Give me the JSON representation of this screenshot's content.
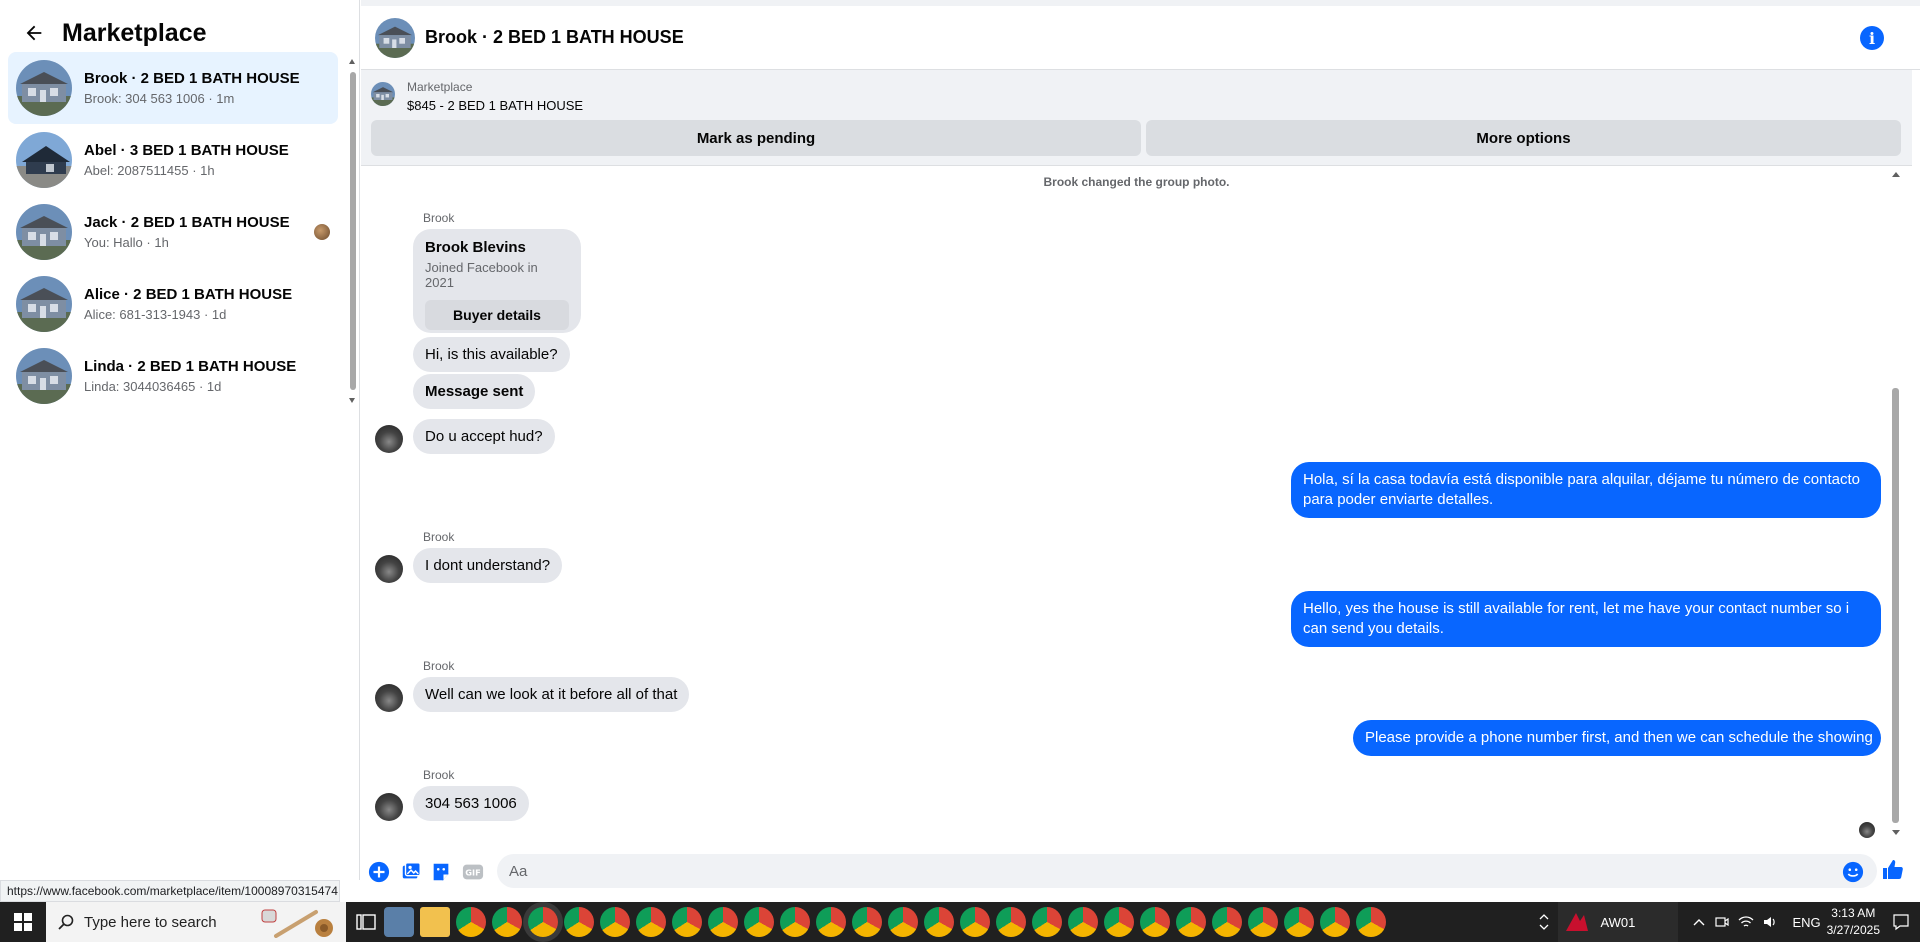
{
  "sidebar": {
    "title": "Marketplace",
    "conversations": [
      {
        "name": "Brook · 2 BED 1 BATH HOUSE",
        "preview": "Brook: 304 563 1006 · 1m"
      },
      {
        "name": "Abel · 3 BED 1 BATH HOUSE",
        "preview": "Abel: 2087511455 · 1h"
      },
      {
        "name": "Jack · 2 BED 1 BATH HOUSE",
        "preview": "You: Hallo · 1h"
      },
      {
        "name": "Alice · 2 BED 1 BATH HOUSE",
        "preview": "Alice: 681-313-1943 · 1d"
      },
      {
        "name": "Linda · 2 BED 1 BATH HOUSE",
        "preview": "Linda: 3044036465 · 1d"
      }
    ]
  },
  "status_url": "https://www.facebook.com/marketplace/item/10008970315474",
  "chat": {
    "title": "Brook · 2 BED 1 BATH HOUSE",
    "listing": {
      "source": "Marketplace",
      "price_title": "$845 - 2 BED 1 BATH HOUSE",
      "mark_pending": "Mark as pending",
      "more_options": "More options"
    },
    "system_note": "Brook changed the group photo.",
    "buyer_card": {
      "sender": "Brook",
      "name": "Brook Blevins",
      "joined": "Joined Facebook in 2021",
      "button": "Buyer details"
    },
    "messages": {
      "m1": "Hi, is this available?",
      "m2": "Message sent",
      "m3": "Do u accept hud?",
      "m4": "Hola, sí la casa todavía está disponible para alquilar, déjame tu número de contacto para poder enviarte detalles.",
      "sender2": "Brook",
      "m5": "I dont understand?",
      "m6": "Hello, yes the house is still available for rent, let me have your contact number so i can send you details.",
      "sender3": "Brook",
      "m7": "Well can we look at it before all of that",
      "m8": "Please provide a phone number first, and then we can schedule the showing",
      "sender4": "Brook",
      "m9": "304 563 1006"
    },
    "composer": {
      "placeholder": "Aa"
    }
  },
  "taskbar": {
    "search_placeholder": "Type here to search",
    "app_label": "AW01",
    "language": "ENG",
    "time": "3:13 AM",
    "date": "3/27/2025"
  },
  "colors": {
    "accent": "#0866ff",
    "active_row": "#e7f3ff",
    "bubble_in": "#e4e6eb"
  }
}
